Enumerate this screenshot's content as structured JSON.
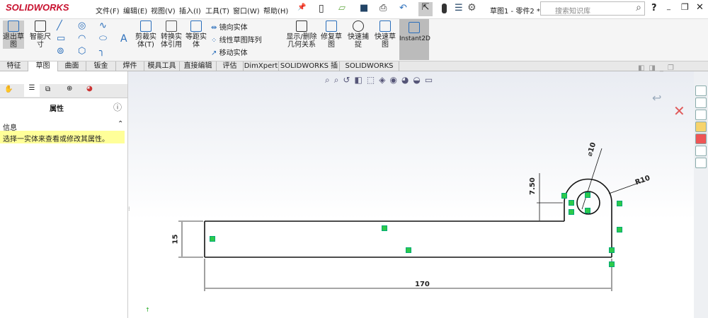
{
  "app": {
    "brand": "SOLIDWORKS",
    "doc_title": "草图1 - 零件2 *",
    "search_placeholder": "搜索知识库",
    "help": "?"
  },
  "menu": [
    "文件(F)",
    "编辑(E)",
    "视图(V)",
    "插入(I)",
    "工具(T)",
    "窗口(W)",
    "帮助(H)"
  ],
  "ribbon": {
    "exit_sketch": "退出草图",
    "smart_dim": "智能尺寸",
    "trim": "剪裁实体(T)",
    "convert": "转换实体引用",
    "offset": "等距实体",
    "mirror": "镜向实体",
    "linear_pattern": "线性草图阵列",
    "move": "移动实体",
    "relations": "显示/删除几何关系",
    "repair": "修复草图",
    "snap": "快速捕捉",
    "rapid_sketch": "快速草图",
    "instant2d": "Instant2D"
  },
  "tabs": [
    "特征",
    "草图",
    "曲面",
    "钣金",
    "焊件",
    "模具工具",
    "直接编辑",
    "评估",
    "DimXpert",
    "SOLIDWORKS 插件",
    "SOLIDWORKS MBD"
  ],
  "panel": {
    "title": "属性",
    "section": "信息",
    "message": "选择一实体来查看或修改其属性。"
  },
  "dims": {
    "length": "170",
    "height": "15",
    "step": "7.50",
    "diameter": "⌀10",
    "radius": "R10"
  }
}
